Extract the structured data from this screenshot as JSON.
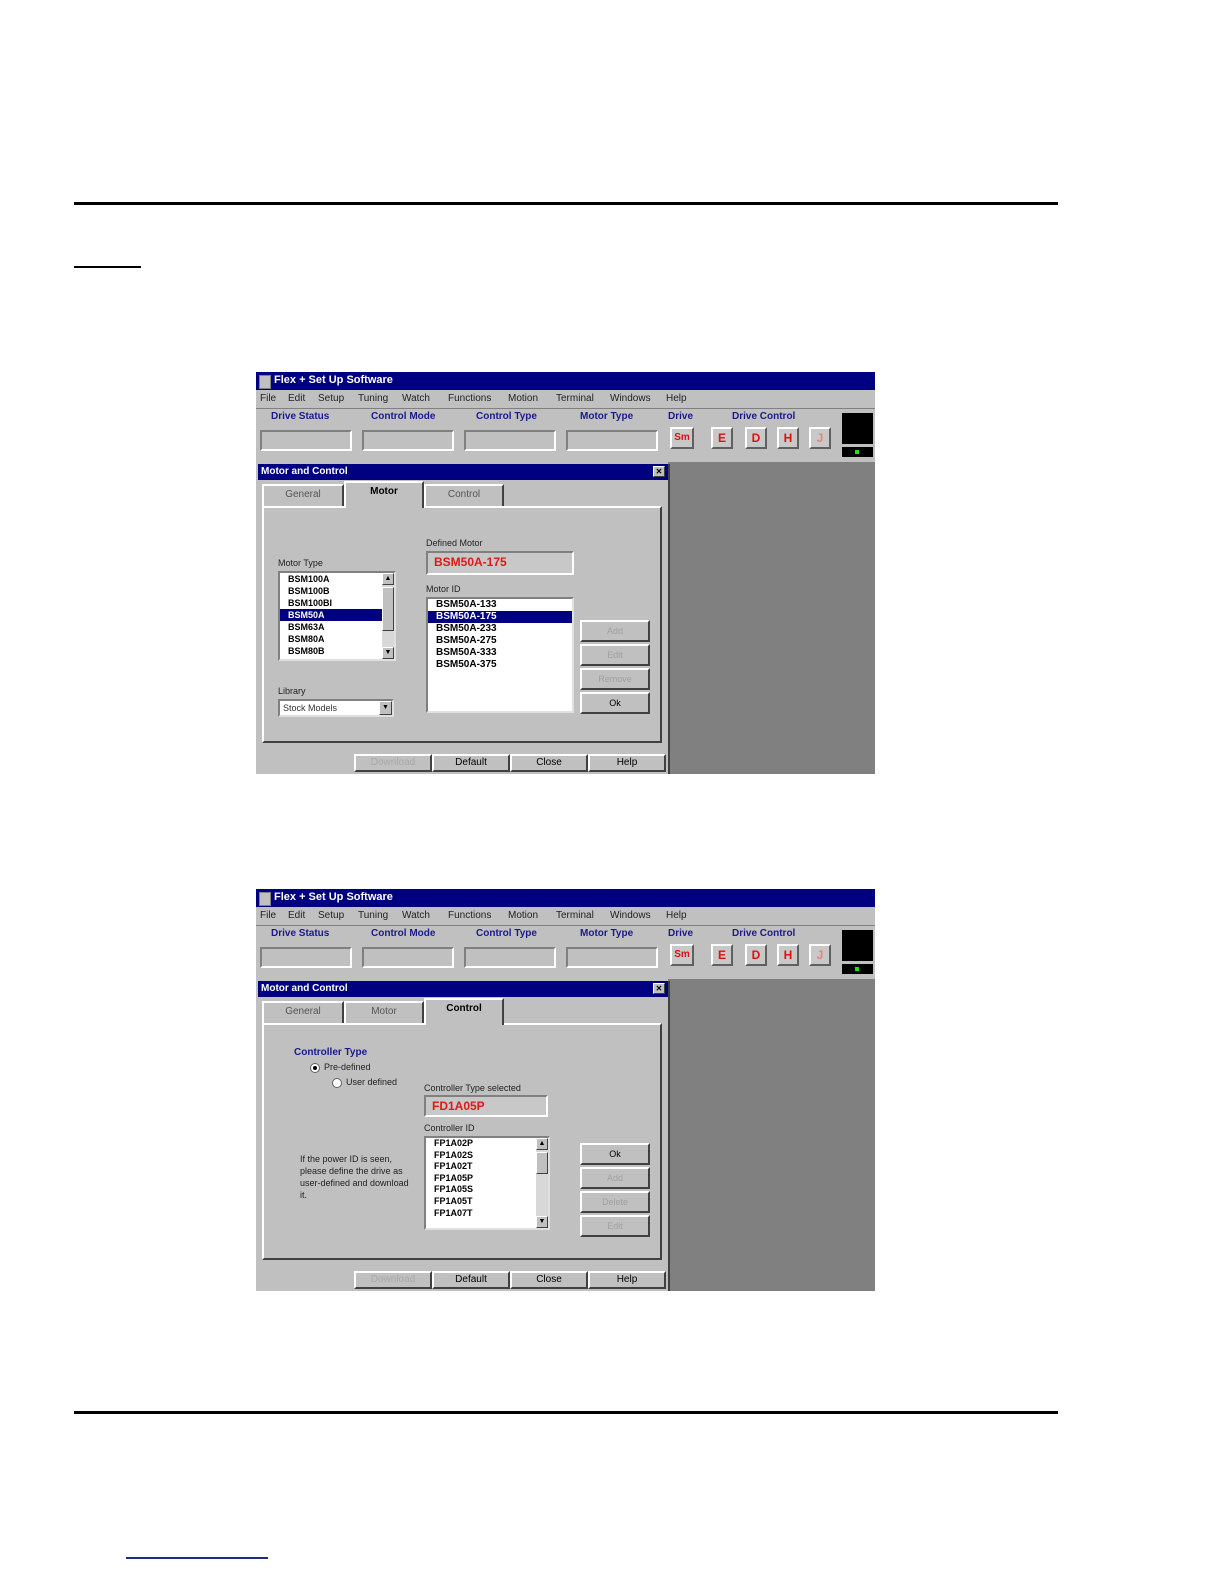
{
  "app": {
    "title": "Flex + Set Up Software",
    "menu": [
      "File",
      "Edit",
      "Setup",
      "Tuning",
      "Watch",
      "Functions",
      "Motion",
      "Terminal",
      "Windows",
      "Help"
    ],
    "toolbar": {
      "labels": {
        "drive_status": "Drive Status",
        "control_mode": "Control Mode",
        "control_type": "Control Type",
        "motor_type": "Motor Type",
        "drive": "Drive",
        "drive_control": "Drive Control"
      },
      "buttons": {
        "drive": "Sm",
        "e": "E",
        "d": "D",
        "h": "H",
        "j": "J"
      }
    }
  },
  "dialog_motor": {
    "title": "Motor and Control",
    "tabs": [
      "General",
      "Motor",
      "Control"
    ],
    "active_tab": "Motor",
    "motor_type_label": "Motor Type",
    "motor_types": [
      "BSM100A",
      "BSM100B",
      "BSM100BI",
      "BSM50A",
      "BSM63A",
      "BSM80A",
      "BSM80B"
    ],
    "motor_type_selected": "BSM50A",
    "library_label": "Library",
    "library_value": "Stock Models",
    "defined_motor_label": "Defined Motor",
    "defined_motor_value": "BSM50A-175",
    "motor_id_label": "Motor ID",
    "motor_ids": [
      "BSM50A-133",
      "BSM50A-175",
      "BSM50A-233",
      "BSM50A-275",
      "BSM50A-333",
      "BSM50A-375"
    ],
    "motor_id_selected": "BSM50A-175",
    "side_buttons": [
      "Add",
      "Edit",
      "Remove",
      "Ok"
    ],
    "bottom_buttons": [
      "Download",
      "Default",
      "Close",
      "Help"
    ]
  },
  "dialog_control": {
    "title": "Motor and Control",
    "tabs": [
      "General",
      "Motor",
      "Control"
    ],
    "active_tab": "Control",
    "controller_type_label": "Controller Type",
    "radio_predefined": "Pre-defined",
    "radio_user_defined": "User defined",
    "selected_label": "Controller Type selected",
    "selected_value": "FD1A05P",
    "controller_id_label": "Controller ID",
    "controller_ids": [
      "FP1A02P",
      "FP1A02S",
      "FP1A02T",
      "FP1A05P",
      "FP1A05S",
      "FP1A05T",
      "FP1A07T"
    ],
    "note": "If the power ID is seen, please define the drive as user-defined and download it.",
    "side_buttons": [
      "Ok",
      "Add",
      "Delete",
      "Edit"
    ],
    "bottom_buttons": [
      "Download",
      "Default",
      "Close",
      "Help"
    ]
  }
}
